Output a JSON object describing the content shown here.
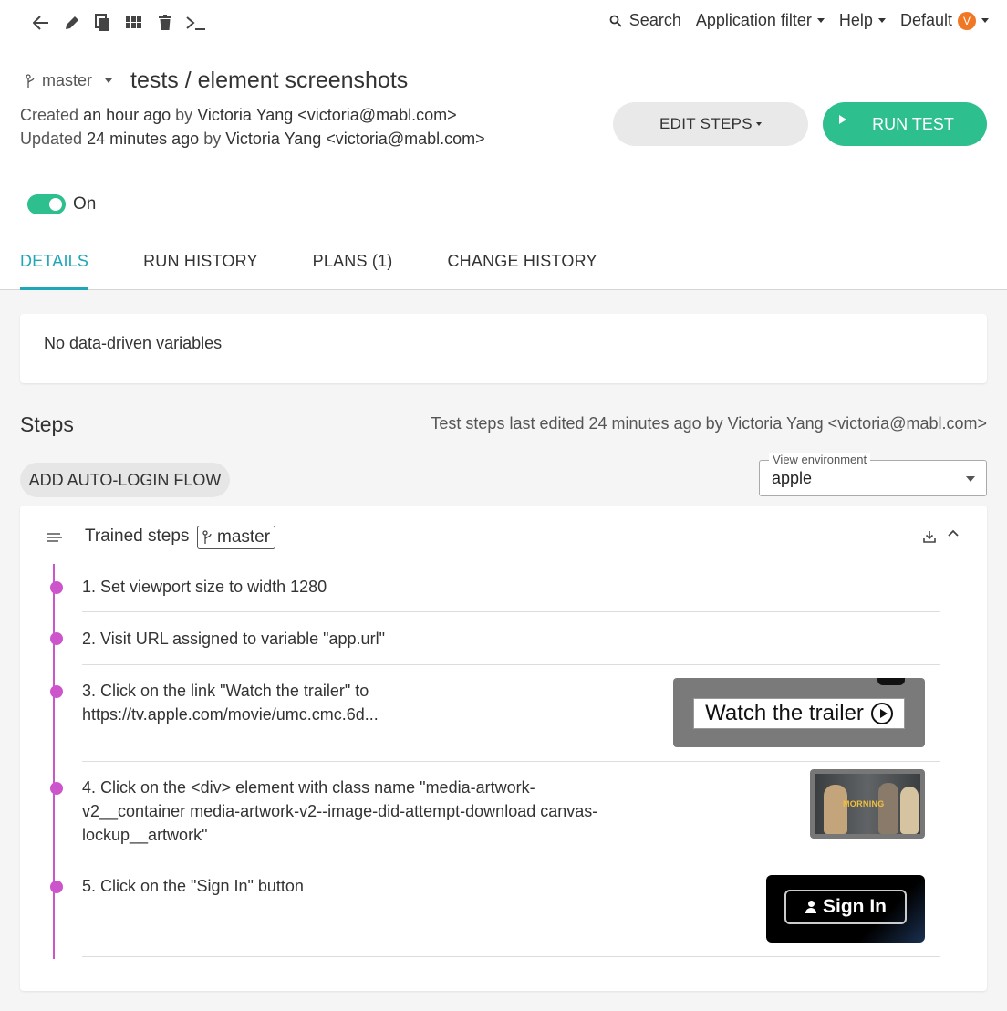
{
  "toolbar": {
    "icons": [
      "back-arrow-icon",
      "pencil-icon",
      "copy-icon",
      "grid-icon",
      "trash-icon",
      "terminal-icon"
    ]
  },
  "topnav": {
    "search_label": "Search",
    "app_filter_label": "Application filter",
    "help_label": "Help",
    "workspace_label": "Default",
    "avatar_initial": "V",
    "avatar_color": "#f07825"
  },
  "header": {
    "branch": "master",
    "title": "tests / element screenshots",
    "created_prefix": "Created",
    "created_time": "an hour ago",
    "created_by_word": "by",
    "created_author": "Victoria Yang <victoria@mabl.com>",
    "updated_prefix": "Updated",
    "updated_time": "24 minutes ago",
    "updated_by_word": "by",
    "updated_author": "Victoria Yang <victoria@mabl.com>",
    "edit_steps_label": "EDIT STEPS",
    "run_test_label": "RUN TEST",
    "accent_color": "#2dbf8e"
  },
  "toggle": {
    "label": "On",
    "enabled": true
  },
  "tabs": [
    {
      "label": "DETAILS",
      "active": true
    },
    {
      "label": "RUN HISTORY",
      "active": false
    },
    {
      "label": "PLANS (1)",
      "active": false
    },
    {
      "label": "CHANGE HISTORY",
      "active": false
    }
  ],
  "variables": {
    "empty_text": "No data-driven variables"
  },
  "steps_section": {
    "heading": "Steps",
    "last_edited": "Test steps last edited 24 minutes ago by Victoria Yang <victoria@mabl.com>",
    "auto_login_label": "ADD AUTO-LOGIN FLOW",
    "environment": {
      "label": "View environment",
      "value": "apple"
    }
  },
  "trained": {
    "title": "Trained steps",
    "branch": "master",
    "timeline_color": "#cc55cc",
    "steps": [
      {
        "text": "1. Set viewport size to width 1280"
      },
      {
        "text": "2. Visit URL assigned to variable \"app.url\""
      },
      {
        "text": "3. Click on the link \"Watch the trailer\" to https://tv.apple.com/movie/umc.cmc.6d...",
        "screenshot_text": "Watch the trailer"
      },
      {
        "text": "4. Click on the <div> element with class name \"media-artwork-v2__container media-artwork-v2--image-did-attempt-download canvas-lockup__artwork\"",
        "screenshot_text": "MORNING"
      },
      {
        "text": "5. Click on the \"Sign In\" button",
        "screenshot_text": "Sign In"
      }
    ]
  }
}
